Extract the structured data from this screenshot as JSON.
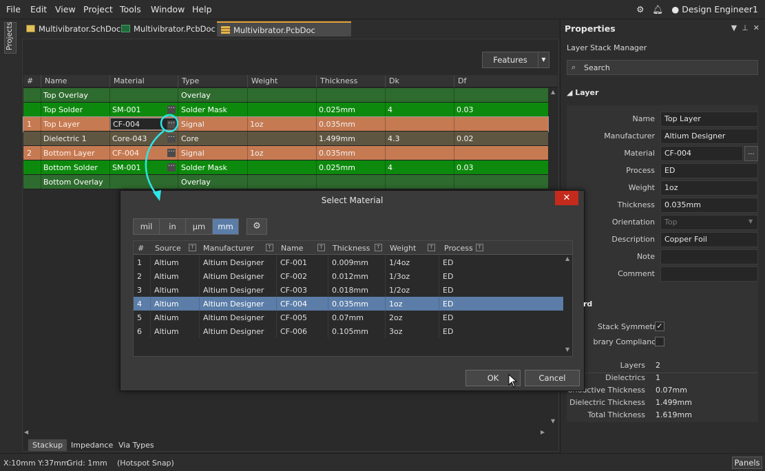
{
  "menu": [
    "File",
    "Edit",
    "View",
    "Project",
    "Tools",
    "Window",
    "Help"
  ],
  "user": "Design Engineer1",
  "sidebar_tab": "Projects",
  "doc_tabs": [
    "Multivibrator.SchDoc",
    "Multivibrator.PcbDoc *",
    "Multivibrator.PcbDoc [Stackup] *"
  ],
  "features_label": "Features",
  "stack_columns": [
    "#",
    "Name",
    "Material",
    "Type",
    "Weight",
    "Thickness",
    "Dk",
    "Df"
  ],
  "stack_rows": [
    {
      "num": "",
      "name": "Top Overlay",
      "material": "",
      "type": "Overlay",
      "weight": "",
      "thickness": "",
      "dk": "",
      "df": "",
      "color": "#2e6b2e"
    },
    {
      "num": "",
      "name": "Top Solder",
      "material": "SM-001",
      "type": "Solder Mask",
      "weight": "",
      "thickness": "0.025mm",
      "dk": "4",
      "df": "0.03",
      "color": "#0d8a0d"
    },
    {
      "num": "1",
      "name": "Top Layer",
      "material": "CF-004",
      "type": "Signal",
      "weight": "1oz",
      "thickness": "0.035mm",
      "dk": "",
      "df": "",
      "color": "#c57a52"
    },
    {
      "num": "",
      "name": "Dielectric 1",
      "material": "Core-043",
      "type": "Core",
      "weight": "",
      "thickness": "1.499mm",
      "dk": "4.3",
      "df": "0.02",
      "color": "#5f5642"
    },
    {
      "num": "2",
      "name": "Bottom Layer",
      "material": "CF-004",
      "type": "Signal",
      "weight": "1oz",
      "thickness": "0.035mm",
      "dk": "",
      "df": "",
      "color": "#c57a52"
    },
    {
      "num": "",
      "name": "Bottom Solder",
      "material": "SM-001",
      "type": "Solder Mask",
      "weight": "",
      "thickness": "0.025mm",
      "dk": "4",
      "df": "0.03",
      "color": "#0d8a0d"
    },
    {
      "num": "",
      "name": "Bottom Overlay",
      "material": "",
      "type": "Overlay",
      "weight": "",
      "thickness": "",
      "dk": "",
      "df": "",
      "color": "#2e6b2e"
    }
  ],
  "bottom_tabs": [
    "Stackup",
    "Impedance",
    "Via Types"
  ],
  "properties": {
    "title": "Properties",
    "subtitle": "Layer Stack Manager",
    "search_placeholder": "Search",
    "layer_section": "Layer",
    "board_section": "rd",
    "fields": [
      {
        "label": "Name",
        "value": "Top Layer"
      },
      {
        "label": "Manufacturer",
        "value": "Altium Designer"
      },
      {
        "label": "Material",
        "value": "CF-004"
      },
      {
        "label": "Process",
        "value": "ED"
      },
      {
        "label": "Weight",
        "value": "1oz"
      },
      {
        "label": "Thickness",
        "value": "0.035mm"
      },
      {
        "label": "Orientation",
        "value": "Top"
      },
      {
        "label": "Description",
        "value": "Copper Foil"
      },
      {
        "label": "Note",
        "value": ""
      },
      {
        "label": "Comment",
        "value": ""
      }
    ],
    "stack_symmetry": "Stack Symmetry",
    "library_compliance": "brary Compliance",
    "stats": [
      {
        "label": "Layers",
        "value": "2"
      },
      {
        "label": "Dielectrics",
        "value": "1"
      },
      {
        "label": "onductive Thickness",
        "value": "0.07mm"
      },
      {
        "label": "Dielectric Thickness",
        "value": "1.499mm"
      },
      {
        "label": "Total Thickness",
        "value": "1.619mm"
      }
    ]
  },
  "dialog": {
    "title": "Select Material",
    "units": [
      "mil",
      "in",
      "µm",
      "mm"
    ],
    "active_unit": "mm",
    "columns": [
      "#",
      "Source",
      "Manufacturer",
      "Name",
      "Thickness",
      "Weight",
      "Process"
    ],
    "rows": [
      {
        "num": "1",
        "source": "Altium",
        "manufacturer": "Altium Designer",
        "name": "CF-001",
        "thickness": "0.009mm",
        "weight": "1/4oz",
        "process": "ED"
      },
      {
        "num": "2",
        "source": "Altium",
        "manufacturer": "Altium Designer",
        "name": "CF-002",
        "thickness": "0.012mm",
        "weight": "1/3oz",
        "process": "ED"
      },
      {
        "num": "3",
        "source": "Altium",
        "manufacturer": "Altium Designer",
        "name": "CF-003",
        "thickness": "0.018mm",
        "weight": "1/2oz",
        "process": "ED"
      },
      {
        "num": "4",
        "source": "Altium",
        "manufacturer": "Altium Designer",
        "name": "CF-004",
        "thickness": "0.035mm",
        "weight": "1oz",
        "process": "ED"
      },
      {
        "num": "5",
        "source": "Altium",
        "manufacturer": "Altium Designer",
        "name": "CF-005",
        "thickness": "0.07mm",
        "weight": "2oz",
        "process": "ED"
      },
      {
        "num": "6",
        "source": "Altium",
        "manufacturer": "Altium Designer",
        "name": "CF-006",
        "thickness": "0.105mm",
        "weight": "3oz",
        "process": "ED"
      }
    ],
    "selected_index": 3,
    "ok": "OK",
    "cancel": "Cancel"
  },
  "status": {
    "coords": "X:10mm Y:37mm",
    "grid": "Grid: 1mm",
    "snap": "(Hotspot Snap)",
    "panels": "Panels"
  },
  "colors": {
    "accent": "#5b7da8",
    "callout": "#2ee6e6",
    "close": "#c42b1c"
  }
}
